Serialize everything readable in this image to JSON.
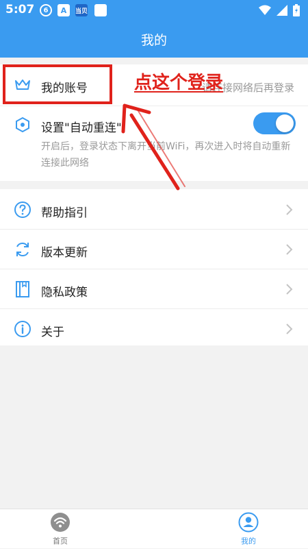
{
  "status_bar": {
    "time": "5:07",
    "icons": [
      "notification-icon",
      "a-icon",
      "app-badge-icon",
      "blank-square-icon"
    ],
    "a_letter": "A",
    "badge_text": "当贝"
  },
  "header": {
    "title": "我的"
  },
  "account": {
    "label": "我的账号",
    "hint": "请连接网络后再登录"
  },
  "auto_reconnect": {
    "label": "设置\"自动重连\"",
    "description": "开启后，登录状态下离开当前WiFi，再次进入时将自动重新连接此网络",
    "enabled": true
  },
  "menu": [
    {
      "label": "帮助指引",
      "icon": "help-icon"
    },
    {
      "label": "版本更新",
      "icon": "refresh-icon"
    },
    {
      "label": "隐私政策",
      "icon": "book-icon"
    },
    {
      "label": "关于",
      "icon": "info-icon"
    }
  ],
  "annotation": {
    "text": "点这个登录"
  },
  "bottom_nav": [
    {
      "label": "首页",
      "icon": "wifi-icon",
      "active": false
    },
    {
      "label": "我的",
      "icon": "user-icon",
      "active": true
    }
  ],
  "colors": {
    "primary": "#3a9bf0",
    "annotation": "#e0221b",
    "text": "#222222",
    "hint": "#9a9a9a",
    "background": "#f2f2f2"
  }
}
